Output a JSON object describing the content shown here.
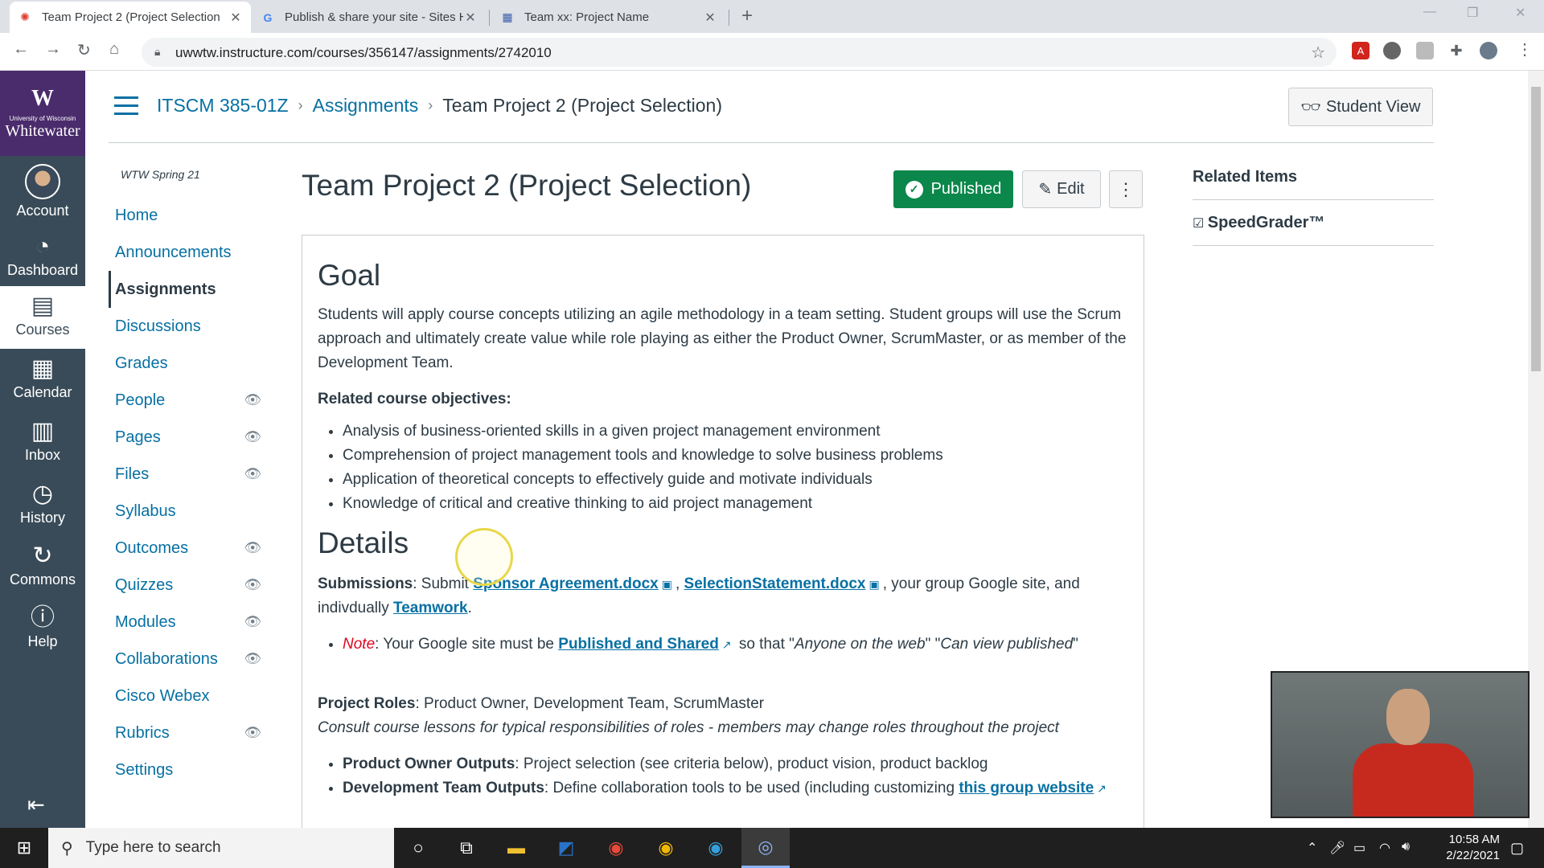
{
  "browser": {
    "tabs": [
      {
        "title": "Team Project 2 (Project Selection",
        "active": true
      },
      {
        "title": "Publish & share your site - Sites H",
        "active": false
      },
      {
        "title": "Team xx: Project Name",
        "active": false
      }
    ],
    "url": "uwwtw.instructure.com/courses/356147/assignments/2742010",
    "new_tab": "+",
    "close": "✕"
  },
  "global_nav": {
    "logo": {
      "mark": "W",
      "line1": "University of Wisconsin",
      "line2": "Whitewater"
    },
    "items": [
      {
        "label": "Account",
        "icon": "avatar-icon"
      },
      {
        "label": "Dashboard",
        "icon": "dashboard-icon"
      },
      {
        "label": "Courses",
        "icon": "courses-icon"
      },
      {
        "label": "Calendar",
        "icon": "calendar-icon"
      },
      {
        "label": "Inbox",
        "icon": "inbox-icon"
      },
      {
        "label": "History",
        "icon": "history-icon"
      },
      {
        "label": "Commons",
        "icon": "commons-icon"
      },
      {
        "label": "Help",
        "icon": "help-icon"
      }
    ],
    "active": "Courses"
  },
  "breadcrumb": {
    "course": "ITSCM 385-01Z",
    "section": "Assignments",
    "current": "Team Project 2 (Project Selection)"
  },
  "student_view": "Student View",
  "course_nav": {
    "term": "WTW Spring 21",
    "items": [
      {
        "label": "Home",
        "hidden": false
      },
      {
        "label": "Announcements",
        "hidden": false
      },
      {
        "label": "Assignments",
        "hidden": false,
        "active": true
      },
      {
        "label": "Discussions",
        "hidden": false
      },
      {
        "label": "Grades",
        "hidden": false
      },
      {
        "label": "People",
        "hidden": true
      },
      {
        "label": "Pages",
        "hidden": true
      },
      {
        "label": "Files",
        "hidden": true
      },
      {
        "label": "Syllabus",
        "hidden": false
      },
      {
        "label": "Outcomes",
        "hidden": true
      },
      {
        "label": "Quizzes",
        "hidden": true
      },
      {
        "label": "Modules",
        "hidden": true
      },
      {
        "label": "Collaborations",
        "hidden": true
      },
      {
        "label": "Cisco Webex",
        "hidden": false
      },
      {
        "label": "Rubrics",
        "hidden": true
      },
      {
        "label": "Settings",
        "hidden": false
      }
    ]
  },
  "assignment": {
    "title": "Team Project 2 (Project Selection)",
    "published_label": "Published",
    "edit_label": "Edit",
    "goal_heading": "Goal",
    "goal_text": "Students will apply course concepts utilizing an agile methodology in a team setting. Student groups will use the Scrum approach and ultimately create value while role playing as either the Product Owner, ScrumMaster, or as member of the Development Team.",
    "objectives_heading": "Related course objectives:",
    "objectives": [
      "Analysis of business-oriented skills in a given project management environment",
      "Comprehension of project management tools and knowledge to solve business problems",
      "Application of theoretical concepts to effectively guide and motivate individuals",
      "Knowledge of critical and creative thinking to aid project management"
    ],
    "details_heading": "Details",
    "submissions_label": "Submissions",
    "submissions_pre": ": Submit ",
    "file1": "Sponsor Agreement.docx",
    "file2": "SelectionStatement.docx",
    "submissions_mid": ", your group Google site, and indivdually ",
    "teamwork": "Teamwork",
    "note_label": "Note",
    "note_pre": ": Your Google site must be ",
    "note_link": "Published and Shared",
    "note_post_1": " so that \"",
    "note_q1": "Anyone on the web",
    "note_post_2": "\" \"",
    "note_q2": "Can view published",
    "note_post_3": "\"",
    "roles_label": "Project Roles",
    "roles_text": ": Product Owner, Development Team, ScrumMaster",
    "roles_italic": "Consult course lessons for typical responsibilities of roles - members may change roles throughout the project",
    "outputs": [
      {
        "label": "Product Owner Outputs",
        "text": ": Project selection (see criteria below), product vision, product backlog"
      },
      {
        "label": "Development Team Outputs",
        "text": ": Define collaboration tools to be used (including customizing ",
        "link": "this group website"
      }
    ]
  },
  "related": {
    "heading": "Related Items",
    "speedgrader": "SpeedGrader™"
  },
  "taskbar": {
    "search_placeholder": "Type here to search",
    "time": "10:58 AM",
    "date": "2/22/2021"
  }
}
